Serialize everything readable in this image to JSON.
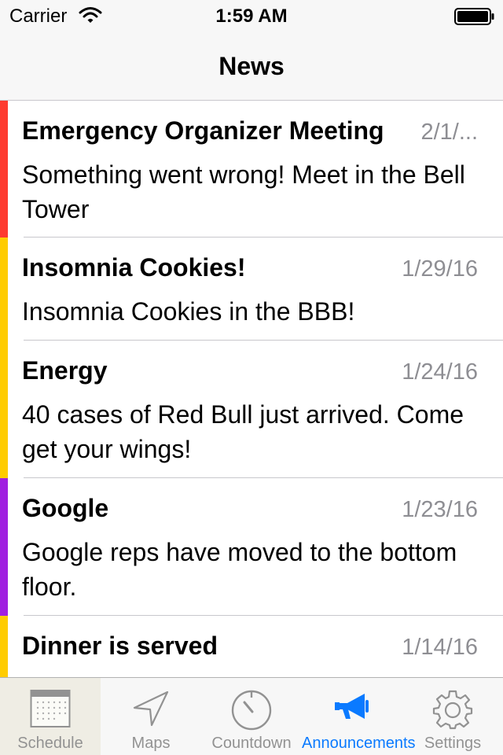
{
  "status_bar": {
    "carrier": "Carrier",
    "time": "1:59 AM"
  },
  "nav": {
    "title": "News"
  },
  "news": [
    {
      "title": "Emergency Organizer Meeting",
      "date": "2/1/...",
      "body": "Something went wrong! Meet in the Bell Tower",
      "accent": "#fe3b30"
    },
    {
      "title": "Insomnia Cookies!",
      "date": "1/29/16",
      "body": "Insomnia Cookies in the BBB!",
      "accent": "#ffcc00"
    },
    {
      "title": "Energy",
      "date": "1/24/16",
      "body": "40 cases of Red Bull just arrived. Come get your wings!",
      "accent": "#ffcc00"
    },
    {
      "title": "Google",
      "date": "1/23/16",
      "body": "Google reps have moved to the bottom floor.",
      "accent": "#a020e0"
    },
    {
      "title": "Dinner is served",
      "date": "1/14/16",
      "body": "",
      "accent": "#ffcc00"
    }
  ],
  "tabs": [
    {
      "label": "Schedule",
      "icon": "calendar-icon"
    },
    {
      "label": "Maps",
      "icon": "location-arrow-icon"
    },
    {
      "label": "Countdown",
      "icon": "stopwatch-icon"
    },
    {
      "label": "Announcements",
      "icon": "megaphone-icon",
      "active": true
    },
    {
      "label": "Settings",
      "icon": "gear-icon"
    }
  ],
  "colors": {
    "active_tab": "#0a7aff",
    "inactive_tab": "#929292"
  }
}
